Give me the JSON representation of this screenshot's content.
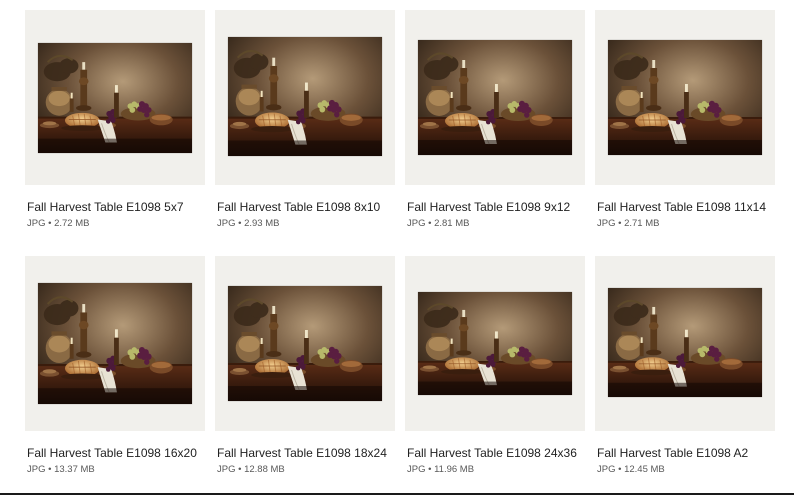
{
  "files": [
    {
      "title": "Fall Harvest Table E1098 5x7",
      "type": "JPG",
      "size": "2.72 MB"
    },
    {
      "title": "Fall Harvest Table E1098 8x10",
      "type": "JPG",
      "size": "2.93 MB"
    },
    {
      "title": "Fall Harvest Table E1098 9x12",
      "type": "JPG",
      "size": "2.81 MB"
    },
    {
      "title": "Fall Harvest Table E1098 11x14",
      "type": "JPG",
      "size": "2.71 MB"
    },
    {
      "title": "Fall Harvest Table E1098 16x20",
      "type": "JPG",
      "size": "13.37 MB"
    },
    {
      "title": "Fall Harvest Table E1098 18x24",
      "type": "JPG",
      "size": "12.88 MB"
    },
    {
      "title": "Fall Harvest Table E1098 24x36",
      "type": "JPG",
      "size": "11.96 MB"
    },
    {
      "title": "Fall Harvest Table E1098 A2",
      "type": "JPG",
      "size": "12.45 MB"
    }
  ],
  "separator": "•",
  "colors": {
    "thumb_background": "#f1f0ec",
    "title_text": "#222222",
    "meta_text": "#595959"
  }
}
